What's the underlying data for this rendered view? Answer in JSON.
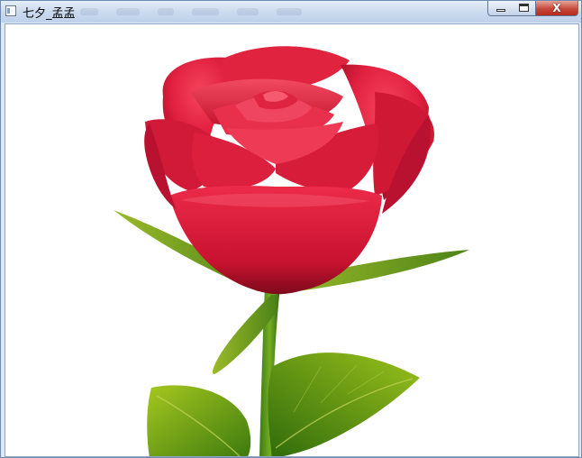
{
  "window": {
    "title": "七夕_孟孟",
    "controls": {
      "minimize_icon": "minimize-icon",
      "maximize_icon": "maximize-icon",
      "close_icon": "close-icon",
      "close_glyph": "X"
    },
    "colors": {
      "titlebar": "#c9d9ee",
      "close_button": "#c7483b",
      "canvas": "#ffffff"
    }
  },
  "canvas": {
    "illustration": "rose-illustration",
    "colors": {
      "petal_light": "#f0304e",
      "petal_dark": "#b8102c",
      "leaf_light": "#9fc31c",
      "leaf_dark": "#3f7d10",
      "stem": "#4e8f17"
    }
  }
}
